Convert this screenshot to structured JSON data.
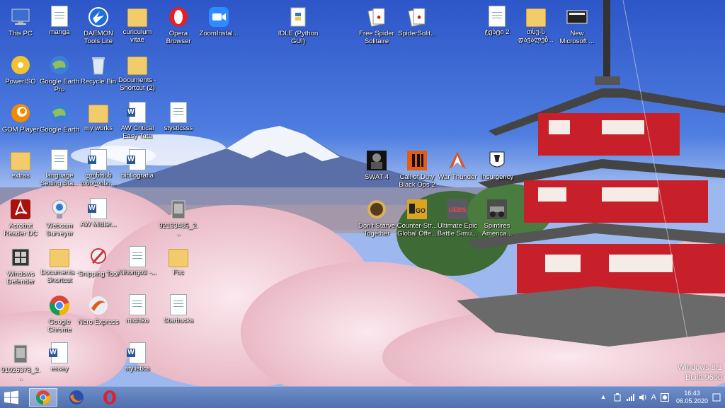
{
  "desktop": {
    "icons": [
      {
        "id": "this-pc",
        "label": "This PC",
        "type": "computer"
      },
      {
        "id": "manga",
        "label": "manga",
        "type": "doc"
      },
      {
        "id": "daemon",
        "label": "DAEMON Tools Lite",
        "type": "daemon"
      },
      {
        "id": "cv",
        "label": "curiculum vitae",
        "type": "folder"
      },
      {
        "id": "opera",
        "label": "Opera Browser",
        "type": "opera"
      },
      {
        "id": "zoom",
        "label": "ZoomInstal...",
        "type": "zoom"
      },
      {
        "id": "idle",
        "label": "IDLE (Python GUI)",
        "type": "python"
      },
      {
        "id": "spider-free",
        "label": "Free Spider Solitaire",
        "type": "cards"
      },
      {
        "id": "spider-sol",
        "label": "SpiderSolit...",
        "type": "cards"
      },
      {
        "id": "geo-doc",
        "label": "ტესტი 2",
        "type": "doc"
      },
      {
        "id": "geo-folder",
        "label": "თსუ-ს დავალებ...",
        "type": "folder"
      },
      {
        "id": "new-ms",
        "label": "New Microsoft ...",
        "type": "newms"
      },
      {
        "id": "poweriso",
        "label": "PowerISO",
        "type": "disc"
      },
      {
        "id": "gearth-pro",
        "label": "Google Earth Pro",
        "type": "earth"
      },
      {
        "id": "recycle",
        "label": "Recycle Bin",
        "type": "recycle"
      },
      {
        "id": "docs-shortcut2",
        "label": "Documents - Shortcut (2)",
        "type": "folder"
      },
      {
        "id": "gom",
        "label": "GOM Player",
        "type": "gom"
      },
      {
        "id": "gearth",
        "label": "Google Earth",
        "type": "earth"
      },
      {
        "id": "myworks",
        "label": "my works",
        "type": "folder"
      },
      {
        "id": "aw-critical",
        "label": "AW Critical Easy Tata",
        "type": "word"
      },
      {
        "id": "stysticsss",
        "label": "stysticsss",
        "type": "doc"
      },
      {
        "id": "extras",
        "label": "extras",
        "type": "folder"
      },
      {
        "id": "language",
        "label": "language Setting.Sta...",
        "type": "doc"
      },
      {
        "id": "geo-word",
        "label": "ლუწოსხ თბილისი...",
        "type": "word"
      },
      {
        "id": "biblio",
        "label": "bibliografia",
        "type": "word"
      },
      {
        "id": "swat4",
        "label": "SWAT 4",
        "type": "swat"
      },
      {
        "id": "cod",
        "label": "Call of Duty Black Ops 2",
        "type": "cod"
      },
      {
        "id": "warthunder",
        "label": "War Thunder",
        "type": "warthunder"
      },
      {
        "id": "insurgency",
        "label": "Insurgency",
        "type": "insurgency"
      },
      {
        "id": "acrobat",
        "label": "Acrobat Reader DC",
        "type": "acrobat"
      },
      {
        "id": "webcam",
        "label": "Webcam Surveyor",
        "type": "webcam"
      },
      {
        "id": "aw-midterm",
        "label": "AW Midter...",
        "type": "word"
      },
      {
        "id": "file9213",
        "label": "92133485_2...",
        "type": "gray"
      },
      {
        "id": "dontstarve",
        "label": "Don't Starve Together",
        "type": "dontstarve"
      },
      {
        "id": "csgo",
        "label": "Counter-Str... Global Offe...",
        "type": "csgo"
      },
      {
        "id": "uebs",
        "label": "Ultimate Epic Battle Simu...",
        "type": "uebs"
      },
      {
        "id": "spintires",
        "label": "Spintires America...",
        "type": "spintires"
      },
      {
        "id": "defender",
        "label": "Windows Defender",
        "type": "defender"
      },
      {
        "id": "docs-shortcut",
        "label": "Documents - Shortcut",
        "type": "folder"
      },
      {
        "id": "snipping",
        "label": "Snipping Tool",
        "type": "snip"
      },
      {
        "id": "nihongo",
        "label": "Nihongo3 -...",
        "type": "doc"
      },
      {
        "id": "fcc",
        "label": "Fcc",
        "type": "folder"
      },
      {
        "id": "chrome",
        "label": "Google Chrome",
        "type": "chrome"
      },
      {
        "id": "nero",
        "label": "Nero Express",
        "type": "nero"
      },
      {
        "id": "michiko",
        "label": "michiko",
        "type": "doc"
      },
      {
        "id": "starbucks",
        "label": "Starbucks",
        "type": "doc"
      },
      {
        "id": "file9102",
        "label": "91026378_2...",
        "type": "gray"
      },
      {
        "id": "essay",
        "label": "essay",
        "type": "word"
      },
      {
        "id": "stylistics",
        "label": "stylistics",
        "type": "word"
      }
    ]
  },
  "watermark": {
    "line1": "Windows 8.1",
    "line2": "Build 9600"
  },
  "taskbar": {
    "apps": [
      {
        "id": "chrome",
        "name": "chrome-icon"
      },
      {
        "id": "firefox",
        "name": "firefox-icon"
      },
      {
        "id": "opera",
        "name": "opera-icon"
      }
    ],
    "tray": {
      "ime": "A",
      "time": "16:43",
      "date": "06.05.2020"
    }
  },
  "colors": {
    "taskbar": "#5878b8",
    "sky": "#3f6ad8",
    "pagoda": "#c8202a",
    "blossom": "#f4d4dc"
  }
}
